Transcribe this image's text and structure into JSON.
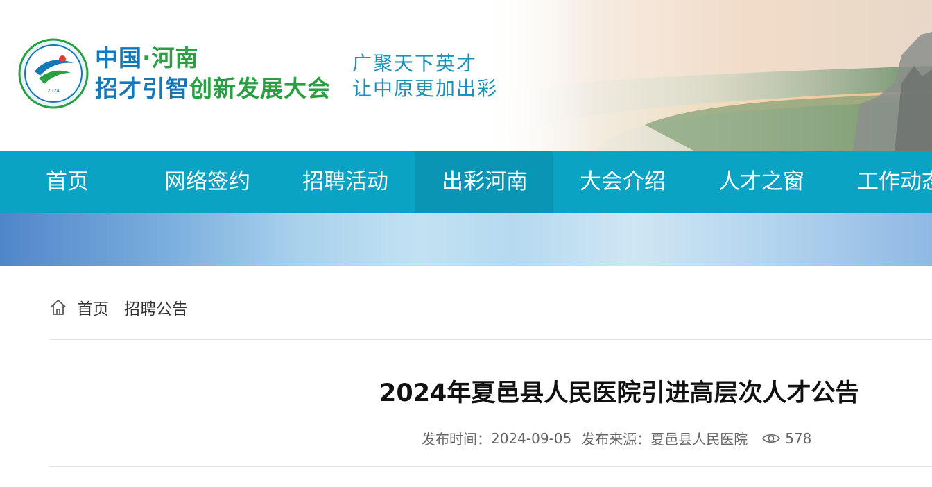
{
  "header": {
    "logo_year": "2024",
    "logo_title_line1_a": "中国",
    "logo_title_line1_dot": "·",
    "logo_title_line1_b": "河南",
    "logo_title_line2_a": "招才引智",
    "logo_title_line2_b": "创新发展大会",
    "slogan_line1": "广聚天下英才",
    "slogan_line2": "让中原更加出彩"
  },
  "nav": {
    "items": [
      {
        "label": "首页"
      },
      {
        "label": "网络签约"
      },
      {
        "label": "招聘活动"
      },
      {
        "label": "出彩河南"
      },
      {
        "label": "大会介绍"
      },
      {
        "label": "人才之窗"
      },
      {
        "label": "工作动态"
      }
    ],
    "active_index": 3
  },
  "breadcrumb": {
    "icon": "home-icon",
    "items": [
      {
        "label": "首页"
      },
      {
        "label": "招聘公告"
      }
    ]
  },
  "article": {
    "title": "2024年夏邑县人民医院引进高层次人才公告",
    "publish_time_label": "发布时间：",
    "publish_time": "2024-09-05",
    "source_label": "发布来源：",
    "source": "夏邑县人民医院",
    "views_icon": "eye-icon",
    "views": "578"
  },
  "colors": {
    "nav_bg": "#0ba3c4",
    "nav_active_bg": "#0a95b4",
    "brand_blue": "#1578b8",
    "brand_green": "#2aa043",
    "slogan": "#1a93b8"
  }
}
